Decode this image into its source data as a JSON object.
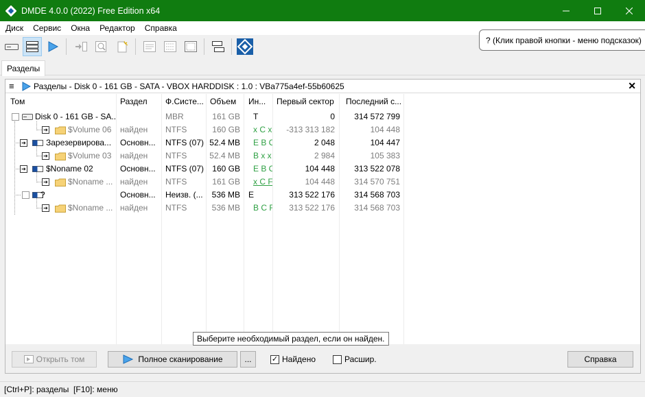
{
  "window": {
    "title": "DMDE 4.0.0 (2022) Free Edition x64",
    "minimize_label": "—",
    "maximize_label": "☐",
    "close_label": "✕"
  },
  "menu": [
    {
      "label": "Диск"
    },
    {
      "label": "Сервис"
    },
    {
      "label": "Окна"
    },
    {
      "label": "Редактор"
    },
    {
      "label": "Справка"
    }
  ],
  "hint_balloon": "? (Клик правой кнопки - меню подсказок)",
  "tabs": [
    {
      "label": "Разделы"
    }
  ],
  "panel": {
    "title": "Разделы - Disk 0 - 161 GB - SATA - VBOX HARDDISK : 1.0 : VBa775a4ef-55b60625"
  },
  "columns": [
    "Том",
    "Раздел",
    "Ф.Систе...",
    "Объем",
    "Ин...",
    "Первый сектор",
    "Последний с..."
  ],
  "rows": [
    {
      "name": "Disk 0 - 161 GB - SA...",
      "part": "",
      "fs": "MBR",
      "size": "161 GB",
      "ind": "T",
      "first": "0",
      "last": "314 572 799"
    },
    {
      "name": "$Volume 06",
      "part": "найден",
      "fs": "NTFS",
      "size": "160 GB",
      "ind": "x C x",
      "first": "-313 313 182",
      "last": "104 448"
    },
    {
      "name": "Зарезервирова...",
      "part": "Основн...",
      "fs": "NTFS (07)",
      "size": "52.4 MB",
      "ind": "E B C F",
      "first": "2 048",
      "last": "104 447"
    },
    {
      "name": "$Volume 03",
      "part": "найден",
      "fs": "NTFS",
      "size": "52.4 MB",
      "ind": "B x x",
      "first": "2 984",
      "last": "105 383"
    },
    {
      "name": "$Noname 02",
      "part": "Основн...",
      "fs": "NTFS (07)",
      "size": "160 GB",
      "ind": "E B C F",
      "first": "104 448",
      "last": "313 522 078"
    },
    {
      "name": "$Noname ...",
      "part": "найден",
      "fs": "NTFS",
      "size": "161 GB",
      "ind": "x C F",
      "first": "104 448",
      "last": "314 570 751"
    },
    {
      "name": "?",
      "part": "Основн...",
      "fs": "Неизв. (...",
      "size": "536 MB",
      "ind": "E",
      "first": "313 522 176",
      "last": "314 568 703"
    },
    {
      "name": "$Noname ...",
      "part": "найден",
      "fs": "NTFS",
      "size": "536 MB",
      "ind": "B C F",
      "first": "313 522 176",
      "last": "314 568 703"
    }
  ],
  "tooltip": "Выберите необходимый раздел, если он найден.",
  "buttons": {
    "open_volume": "Открыть том",
    "full_scan": "Полное сканирование",
    "more": "...",
    "help": "Справка"
  },
  "checkboxes": {
    "found": {
      "label": "Найдено",
      "checked": true
    },
    "extended": {
      "label": "Расшир.",
      "checked": false
    }
  },
  "status_text": "[Ctrl+P]: разделы  [F10]: меню",
  "colors": {
    "titlebar": "#107c10",
    "accent": "#2e8ad8",
    "green_text": "#2ea043"
  }
}
